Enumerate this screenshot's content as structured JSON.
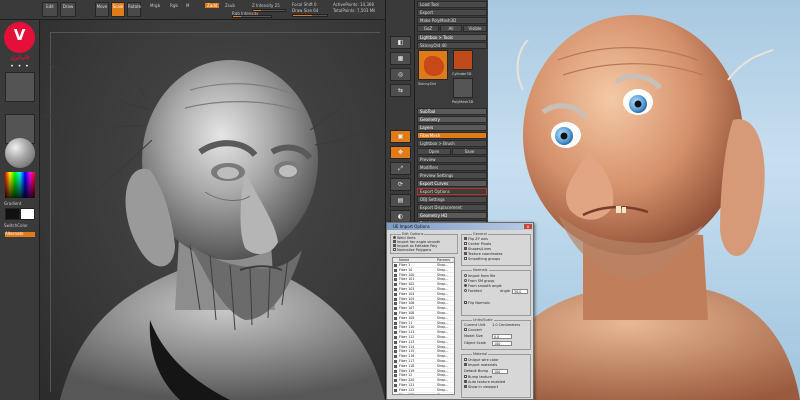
{
  "logo": {
    "glyph": "V",
    "text": "تاپ‌لرن",
    "icon": "logo-badge"
  },
  "colors": {
    "accent": "#e07b1a",
    "brand": "#e4103a",
    "ui_dark": "#3a3a3a"
  },
  "toolbar": {
    "btn_edit": "Edit",
    "btn_draw": "Draw",
    "btn_move": "Move",
    "btn_scale": "Scale",
    "btn_rotate": "Rotate",
    "lbl_mrgb": "Mrgb",
    "lbl_rgb": "Rgb",
    "lbl_m": "M",
    "lbl_zadd": "Zadd",
    "lbl_zsub": "Zsub",
    "lbl_focal": "Focal Shift 0",
    "lbl_draw_size": "Draw Size 64",
    "lbl_rgb_intensity": "Rgb Intensity",
    "lbl_z_intensity": "Z Intensity 25",
    "lbl_active_points": "ActivePoints: 14,366",
    "lbl_total_points": "TotalPoints: 7,503 Mil",
    "draw_size_level": 0.55,
    "z_intensity_level": 0.25
  },
  "left_shelf": {
    "gradient_label": "Gradient",
    "switch_color_label": "SwitchColor",
    "alternate_label": "Alternate"
  },
  "right_icons": [
    "Persp",
    "Floor",
    "Local",
    "L.Sym",
    "Frame",
    "Move",
    "Scale",
    "Rotate",
    "PolyF",
    "Transp",
    "Solo"
  ],
  "palette": {
    "rows_top": [
      "Load Tool",
      "Save As",
      "Copy Tool",
      "Paste Tool",
      "Import",
      "Export",
      "Clone",
      "Make PolyMesh3D",
      "GoZ",
      "All",
      "Visible",
      "R",
      "Lightbox > Tools",
      "SkinnyOld  40"
    ],
    "thumbs": [
      "SkinnyOld",
      "Cylinder3D",
      "PolyMesh3D",
      "SkinnyOld"
    ],
    "rows_mid": [
      "SubTool",
      "Geometry",
      "Layers",
      "FiberMesh",
      "Lightbox > Brush",
      "Open",
      "Save",
      "Geometry",
      "Preview",
      "Modifiers",
      "Preview Settings",
      "Export Curves",
      "Export Options",
      "OBJ Settings",
      "Export Displacement",
      "Geometry HD",
      "Preview",
      "Surface",
      "Deformation",
      "Masking"
    ]
  },
  "dialog": {
    "title": "UE Import Options",
    "close": "x",
    "group_edit": "Edit Options",
    "opt_weld": "Weld Verts",
    "opt_import_flag": "Import Flat",
    "opt_smooth": "Import fan angle smooth",
    "opt_editable": "Import as Editable Poly",
    "opt_normalize": "Normalize Polygons",
    "group_general": "General",
    "opt_flip": "Flip ZY axis",
    "opt_center": "Center Pivots",
    "opt_shapes": "Shapes/Lines",
    "opt_texcoords": "Texture coordinates",
    "opt_smoothing": "Smoothing groups",
    "group_normals": "Normals",
    "opt_from_file": "Import from file",
    "opt_from_sm": "From SM group",
    "opt_from_angle": "From smooth angle",
    "opt_faceted": "Faceted",
    "opt_flip_normals": "Flip Normals",
    "angle_label": "Angle",
    "angle_value": "30.0",
    "group_scale": "Units/Scale",
    "units_value": "1.0 Centimeters",
    "current_label": "Current Unit",
    "convert_label": "Convert",
    "model_size_label": "Model Size",
    "model_size_value": "0.0",
    "object_scale_label": "Object Scale",
    "object_scale_value": "100",
    "group_material": "Material",
    "opt_unique_mtl": "Unique wire color",
    "opt_import_materials": "Import materials",
    "opt_default_bump": "Default Bump",
    "default_bump_value": "100",
    "opt_bump_texture": "Bump texture",
    "opt_auto_bump": "Auto texture enabled",
    "opt_show_viewport": "Show in viewport",
    "list_headers": {
      "name": "Name",
      "params": "Params"
    },
    "list_rows": [
      {
        "name": "Fiber 1",
        "params": "Shap..."
      },
      {
        "name": "Fiber 10",
        "params": "Shap..."
      },
      {
        "name": "Fiber 100",
        "params": "Shap..."
      },
      {
        "name": "Fiber 101",
        "params": "Shap..."
      },
      {
        "name": "Fiber 102",
        "params": "Shap..."
      },
      {
        "name": "Fiber 103",
        "params": "Shap..."
      },
      {
        "name": "Fiber 104",
        "params": "Shap..."
      },
      {
        "name": "Fiber 105",
        "params": "Shap..."
      },
      {
        "name": "Fiber 106",
        "params": "Shap..."
      },
      {
        "name": "Fiber 107",
        "params": "Shap..."
      },
      {
        "name": "Fiber 108",
        "params": "Shap..."
      },
      {
        "name": "Fiber 109",
        "params": "Shap..."
      },
      {
        "name": "Fiber 11",
        "params": "Shap..."
      },
      {
        "name": "Fiber 110",
        "params": "Shap..."
      },
      {
        "name": "Fiber 111",
        "params": "Shap..."
      },
      {
        "name": "Fiber 112",
        "params": "Shap..."
      },
      {
        "name": "Fiber 113",
        "params": "Shap..."
      },
      {
        "name": "Fiber 114",
        "params": "Shap..."
      },
      {
        "name": "Fiber 115",
        "params": "Shap..."
      },
      {
        "name": "Fiber 116",
        "params": "Shap..."
      },
      {
        "name": "Fiber 117",
        "params": "Shap..."
      },
      {
        "name": "Fiber 118",
        "params": "Shap..."
      },
      {
        "name": "Fiber 119",
        "params": "Shap..."
      },
      {
        "name": "Fiber 12",
        "params": "Shap..."
      },
      {
        "name": "Fiber 120",
        "params": "Shap..."
      },
      {
        "name": "Fiber 121",
        "params": "Shap..."
      },
      {
        "name": "Fiber 122",
        "params": "Shap..."
      },
      {
        "name": "Fiber 123",
        "params": "Shap..."
      }
    ]
  }
}
